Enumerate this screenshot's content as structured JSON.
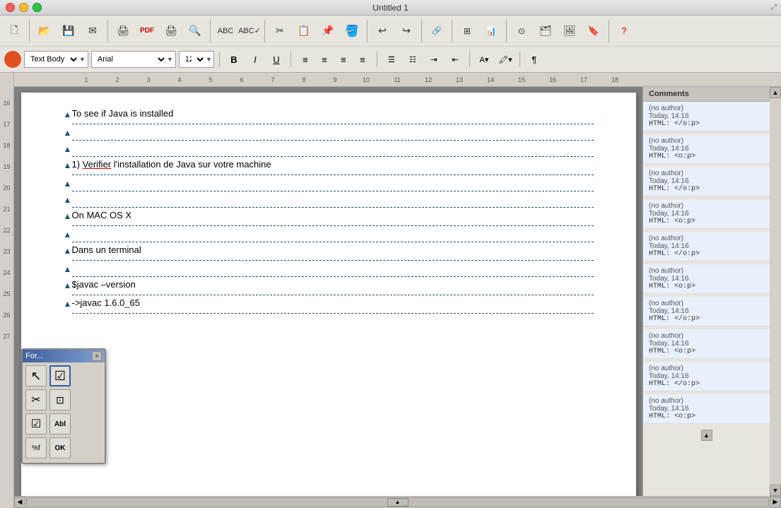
{
  "window": {
    "title": "Untitled 1",
    "controls": {
      "close": "close",
      "minimize": "minimize",
      "maximize": "maximize"
    }
  },
  "toolbar": {
    "style_label": "Text Body",
    "font_label": "Arial",
    "size_label": "12",
    "buttons": {
      "bold": "B",
      "italic": "I",
      "underline": "U",
      "align_left": "≡",
      "align_center": "≡",
      "align_right": "≡",
      "align_justify": "≡"
    }
  },
  "ruler": {
    "numbers": [
      1,
      2,
      3,
      4,
      5,
      6,
      7,
      8,
      9,
      10,
      11,
      12,
      13,
      14,
      15,
      16,
      17,
      18
    ],
    "left_numbers": [
      16,
      17,
      18,
      19,
      20,
      21,
      22,
      23,
      24,
      25,
      26,
      27
    ]
  },
  "document": {
    "lines": [
      {
        "text": "To see if Java is installed",
        "type": "text",
        "has_arrow": true,
        "has_border": true
      },
      {
        "text": "",
        "type": "empty",
        "has_arrow": true,
        "has_border": true
      },
      {
        "text": "",
        "type": "empty",
        "has_arrow": true,
        "has_border": true
      },
      {
        "text": "1) Verifier l’installation de Java sur votre machine",
        "type": "text",
        "has_arrow": true,
        "has_border": true
      },
      {
        "text": "",
        "type": "empty",
        "has_arrow": true,
        "has_border": true
      },
      {
        "text": "",
        "type": "empty",
        "has_arrow": true,
        "has_border": true
      },
      {
        "text": "On MAC OS X",
        "type": "text",
        "has_arrow": true,
        "has_border": true
      },
      {
        "text": "",
        "type": "empty",
        "has_arrow": true,
        "has_border": true
      },
      {
        "text": "Dans un terminal",
        "type": "text",
        "has_arrow": true,
        "has_border": true
      },
      {
        "text": "",
        "type": "empty",
        "has_arrow": true,
        "has_border": true
      },
      {
        "text": "$javac –version",
        "type": "text",
        "has_arrow": true,
        "has_border": true
      },
      {
        "text": "->javac 1.6.0_65",
        "type": "text",
        "has_arrow": true,
        "has_border": true
      }
    ]
  },
  "comments": {
    "header": "Comments",
    "items": [
      {
        "author": "(no author)",
        "time": "Today, 14:16",
        "html": "HTML: </o:p>"
      },
      {
        "author": "(no author)",
        "time": "Today, 14:16",
        "html": "HTML: <o:p>"
      },
      {
        "author": "(no author)",
        "time": "Today, 14:16",
        "html": "HTML: </o:p>"
      },
      {
        "author": "(no author)",
        "time": "Today, 14:16",
        "html": "HTML: <o:p>"
      },
      {
        "author": "(no author)",
        "time": "Today, 14:16",
        "html": "HTML: </o:p>"
      },
      {
        "author": "(no author)",
        "time": "Today, 14:16",
        "html": "HTML: <o:p>"
      },
      {
        "author": "(no author)",
        "time": "Today, 14:16",
        "html": "HTML: </o:p>"
      },
      {
        "author": "(no author)",
        "time": "Today, 14:16",
        "html": "HTML: <o:p>"
      },
      {
        "author": "(no author)",
        "time": "Today, 14:16",
        "html": "HTML: </o:p>"
      },
      {
        "author": "(no author)",
        "time": "Today, 14:16",
        "html": "HTML: <o:p>"
      }
    ]
  },
  "float_toolbar": {
    "title": "For...",
    "close_label": "×",
    "buttons": [
      {
        "icon": "↖",
        "name": "select-tool"
      },
      {
        "icon": "☑",
        "name": "form-control"
      },
      {
        "icon": "✂",
        "name": "cut-tool"
      },
      {
        "icon": "⊡",
        "name": "image-control"
      },
      {
        "icon": "✓",
        "name": "checkbox"
      },
      {
        "icon": "Abl",
        "name": "label-control"
      },
      {
        "icon": "%f",
        "name": "format-field"
      },
      {
        "icon": "OK",
        "name": "ok-button"
      }
    ]
  }
}
